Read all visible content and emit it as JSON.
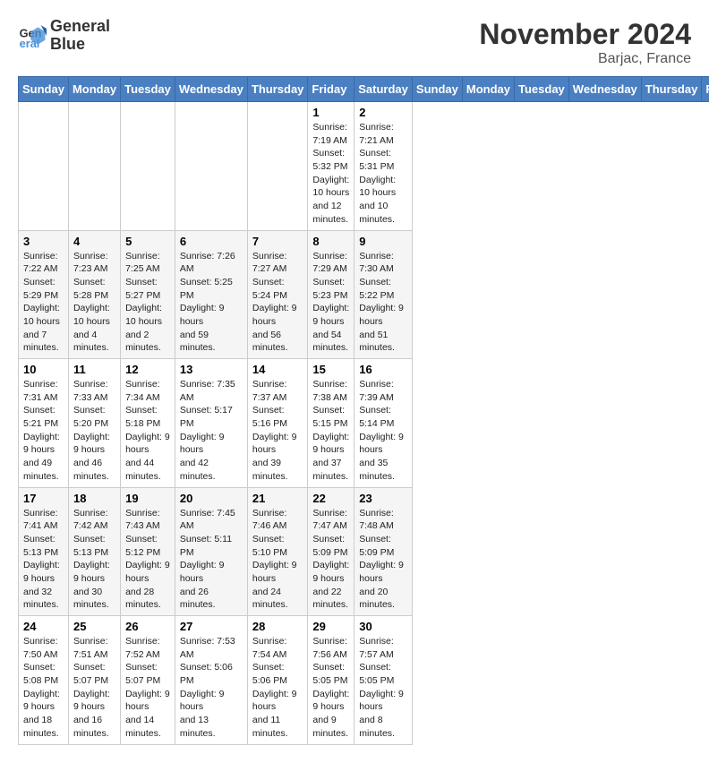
{
  "logo": {
    "line1": "General",
    "line2": "Blue"
  },
  "title": "November 2024",
  "location": "Barjac, France",
  "days_header": [
    "Sunday",
    "Monday",
    "Tuesday",
    "Wednesday",
    "Thursday",
    "Friday",
    "Saturday"
  ],
  "weeks": [
    [
      {
        "day": "",
        "info": ""
      },
      {
        "day": "",
        "info": ""
      },
      {
        "day": "",
        "info": ""
      },
      {
        "day": "",
        "info": ""
      },
      {
        "day": "",
        "info": ""
      },
      {
        "day": "1",
        "info": "Sunrise: 7:19 AM\nSunset: 5:32 PM\nDaylight: 10 hours\nand 12 minutes."
      },
      {
        "day": "2",
        "info": "Sunrise: 7:21 AM\nSunset: 5:31 PM\nDaylight: 10 hours\nand 10 minutes."
      }
    ],
    [
      {
        "day": "3",
        "info": "Sunrise: 7:22 AM\nSunset: 5:29 PM\nDaylight: 10 hours\nand 7 minutes."
      },
      {
        "day": "4",
        "info": "Sunrise: 7:23 AM\nSunset: 5:28 PM\nDaylight: 10 hours\nand 4 minutes."
      },
      {
        "day": "5",
        "info": "Sunrise: 7:25 AM\nSunset: 5:27 PM\nDaylight: 10 hours\nand 2 minutes."
      },
      {
        "day": "6",
        "info": "Sunrise: 7:26 AM\nSunset: 5:25 PM\nDaylight: 9 hours\nand 59 minutes."
      },
      {
        "day": "7",
        "info": "Sunrise: 7:27 AM\nSunset: 5:24 PM\nDaylight: 9 hours\nand 56 minutes."
      },
      {
        "day": "8",
        "info": "Sunrise: 7:29 AM\nSunset: 5:23 PM\nDaylight: 9 hours\nand 54 minutes."
      },
      {
        "day": "9",
        "info": "Sunrise: 7:30 AM\nSunset: 5:22 PM\nDaylight: 9 hours\nand 51 minutes."
      }
    ],
    [
      {
        "day": "10",
        "info": "Sunrise: 7:31 AM\nSunset: 5:21 PM\nDaylight: 9 hours\nand 49 minutes."
      },
      {
        "day": "11",
        "info": "Sunrise: 7:33 AM\nSunset: 5:20 PM\nDaylight: 9 hours\nand 46 minutes."
      },
      {
        "day": "12",
        "info": "Sunrise: 7:34 AM\nSunset: 5:18 PM\nDaylight: 9 hours\nand 44 minutes."
      },
      {
        "day": "13",
        "info": "Sunrise: 7:35 AM\nSunset: 5:17 PM\nDaylight: 9 hours\nand 42 minutes."
      },
      {
        "day": "14",
        "info": "Sunrise: 7:37 AM\nSunset: 5:16 PM\nDaylight: 9 hours\nand 39 minutes."
      },
      {
        "day": "15",
        "info": "Sunrise: 7:38 AM\nSunset: 5:15 PM\nDaylight: 9 hours\nand 37 minutes."
      },
      {
        "day": "16",
        "info": "Sunrise: 7:39 AM\nSunset: 5:14 PM\nDaylight: 9 hours\nand 35 minutes."
      }
    ],
    [
      {
        "day": "17",
        "info": "Sunrise: 7:41 AM\nSunset: 5:13 PM\nDaylight: 9 hours\nand 32 minutes."
      },
      {
        "day": "18",
        "info": "Sunrise: 7:42 AM\nSunset: 5:13 PM\nDaylight: 9 hours\nand 30 minutes."
      },
      {
        "day": "19",
        "info": "Sunrise: 7:43 AM\nSunset: 5:12 PM\nDaylight: 9 hours\nand 28 minutes."
      },
      {
        "day": "20",
        "info": "Sunrise: 7:45 AM\nSunset: 5:11 PM\nDaylight: 9 hours\nand 26 minutes."
      },
      {
        "day": "21",
        "info": "Sunrise: 7:46 AM\nSunset: 5:10 PM\nDaylight: 9 hours\nand 24 minutes."
      },
      {
        "day": "22",
        "info": "Sunrise: 7:47 AM\nSunset: 5:09 PM\nDaylight: 9 hours\nand 22 minutes."
      },
      {
        "day": "23",
        "info": "Sunrise: 7:48 AM\nSunset: 5:09 PM\nDaylight: 9 hours\nand 20 minutes."
      }
    ],
    [
      {
        "day": "24",
        "info": "Sunrise: 7:50 AM\nSunset: 5:08 PM\nDaylight: 9 hours\nand 18 minutes."
      },
      {
        "day": "25",
        "info": "Sunrise: 7:51 AM\nSunset: 5:07 PM\nDaylight: 9 hours\nand 16 minutes."
      },
      {
        "day": "26",
        "info": "Sunrise: 7:52 AM\nSunset: 5:07 PM\nDaylight: 9 hours\nand 14 minutes."
      },
      {
        "day": "27",
        "info": "Sunrise: 7:53 AM\nSunset: 5:06 PM\nDaylight: 9 hours\nand 13 minutes."
      },
      {
        "day": "28",
        "info": "Sunrise: 7:54 AM\nSunset: 5:06 PM\nDaylight: 9 hours\nand 11 minutes."
      },
      {
        "day": "29",
        "info": "Sunrise: 7:56 AM\nSunset: 5:05 PM\nDaylight: 9 hours\nand 9 minutes."
      },
      {
        "day": "30",
        "info": "Sunrise: 7:57 AM\nSunset: 5:05 PM\nDaylight: 9 hours\nand 8 minutes."
      }
    ]
  ]
}
